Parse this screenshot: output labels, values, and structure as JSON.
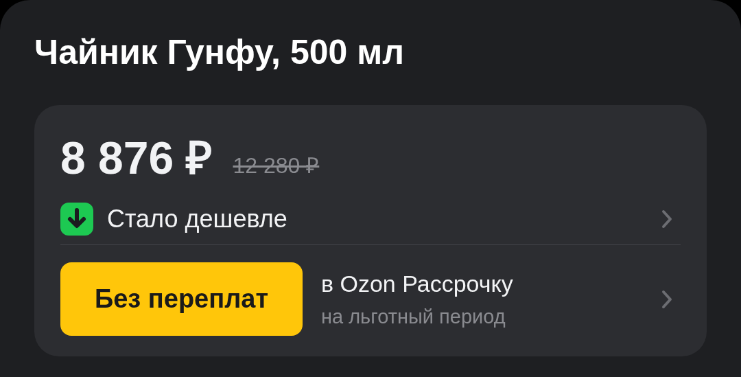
{
  "title": "Чайник Гунфу, 500 мл",
  "price": {
    "current": "8 876 ₽",
    "old": "12 280 ₽"
  },
  "rows": [
    {
      "kind": "notice",
      "label": "Стало дешевле"
    },
    {
      "kind": "installment",
      "button": "Без переплат",
      "line1": "в Ozon Рассрочку",
      "line2": "на льготный период"
    }
  ]
}
